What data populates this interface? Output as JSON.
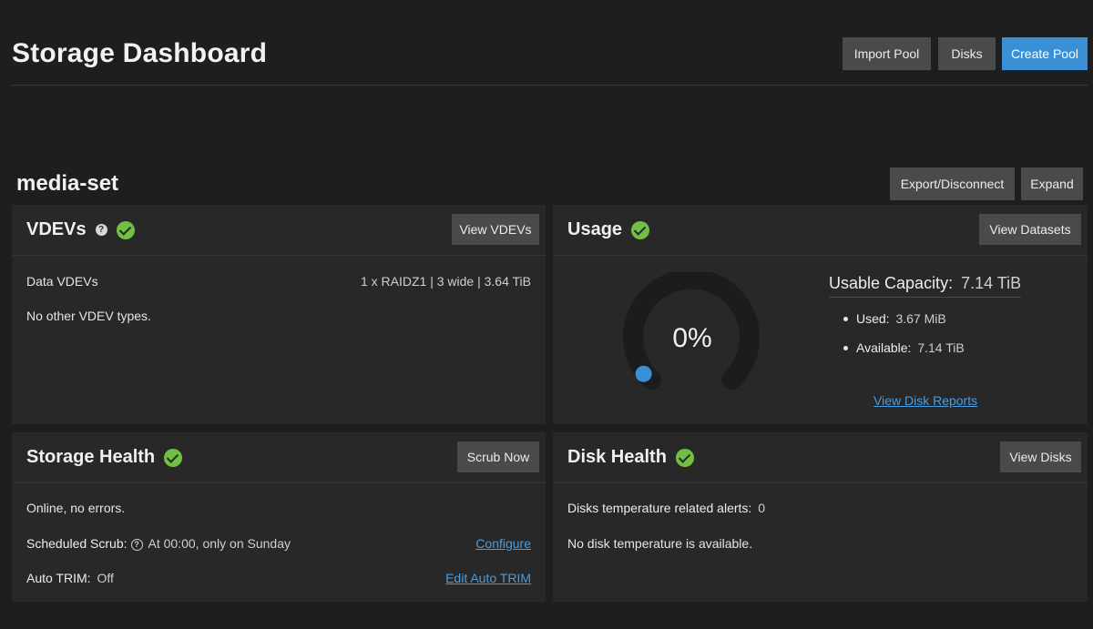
{
  "page": {
    "title": "Storage Dashboard",
    "buttons": {
      "import_pool": "Import Pool",
      "disks": "Disks",
      "create_pool": "Create Pool"
    }
  },
  "pool": {
    "name": "media-set",
    "buttons": {
      "export": "Export/Disconnect",
      "expand": "Expand"
    }
  },
  "vdevs": {
    "title": "VDEVs",
    "status_icon": "check-circle-icon",
    "button": "View VDEVs",
    "data_label": "Data VDEVs",
    "data_value": "1 x RAIDZ1 | 3 wide | 3.64 TiB",
    "other": "No other VDEV types."
  },
  "usage": {
    "title": "Usage",
    "status_icon": "check-circle-icon",
    "button": "View Datasets",
    "percent_text": "0%",
    "percent_value": 0,
    "capacity_label": "Usable Capacity:",
    "capacity_value": "7.14 TiB",
    "used_label": "Used:",
    "used_value": "3.67 MiB",
    "available_label": "Available:",
    "available_value": "7.14 TiB",
    "reports_link": "View Disk Reports"
  },
  "storage_health": {
    "title": "Storage Health",
    "status_icon": "check-circle-icon",
    "button": "Scrub Now",
    "status": "Online, no errors.",
    "scrub_label": "Scheduled Scrub:",
    "scrub_value": "At 00:00, only on Sunday",
    "configure_link": "Configure",
    "trim_label": "Auto TRIM:",
    "trim_value": "Off",
    "trim_link": "Edit Auto TRIM"
  },
  "disk_health": {
    "title": "Disk Health",
    "status_icon": "check-circle-icon",
    "button": "View Disks",
    "temp_alerts_label": "Disks temperature related alerts:",
    "temp_alerts_value": "0",
    "temp_note": "No disk temperature is available."
  },
  "colors": {
    "background": "#1e1e1e",
    "card": "#282828",
    "button": "#4a4a4a",
    "primary": "#3a90d6",
    "success": "#71bf44",
    "link": "#4a9de0",
    "gauge_track": "#1c1c1c",
    "gauge_indicator": "#3a90d6"
  }
}
